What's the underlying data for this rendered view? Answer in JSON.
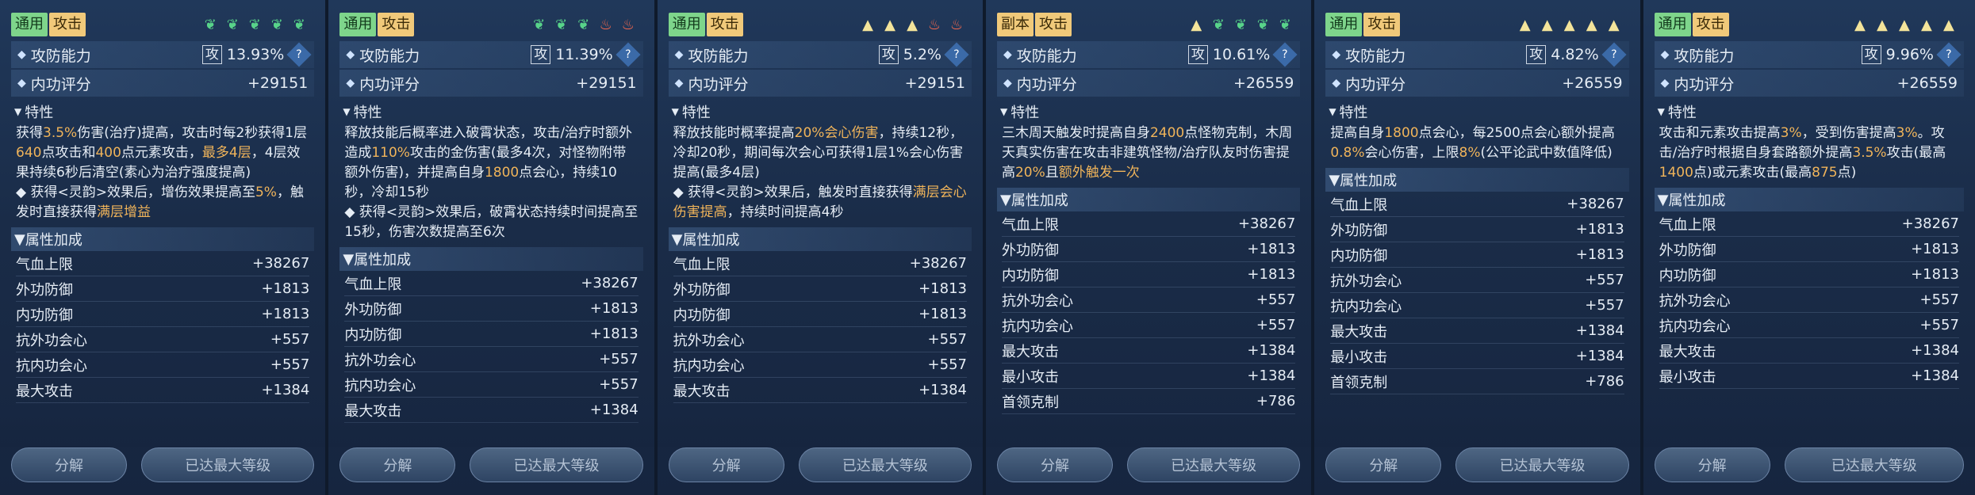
{
  "cards": [
    {
      "tags": [
        {
          "text": "通用",
          "color": "green"
        },
        {
          "text": "攻击",
          "color": "yellow"
        }
      ],
      "icons": [
        "leaf",
        "leaf",
        "leaf",
        "leaf",
        "leaf"
      ],
      "gf_label": "攻防能力",
      "gf_box": "攻",
      "gf_val": "13.93%",
      "q": "?",
      "ng_label": "内功评分",
      "ng_val": "+29151",
      "trait_label": "特性",
      "desc": "获得<span class=hl>3.5%</span>伤害(治疗)提高，攻击时每2秒获得1层<span class=hl>640</span>点攻击和<span class=hl>400</span>点元素攻击，<span class=hl>最多4层</span>，4层效果持续6秒后清空(素心为治疗强度提高)<br>◆ 获得<灵韵>效果后，增伤效果提高至<span class=hl>5%</span>，触发时直接获得<span class=hl>满层增益</span>",
      "attr_label": "属性加成",
      "attrs": [
        [
          "气血上限",
          "+38267"
        ],
        [
          "外功防御",
          "+1813"
        ],
        [
          "内功防御",
          "+1813"
        ],
        [
          "抗外功会心",
          "+557"
        ],
        [
          "抗内功会心",
          "+557"
        ],
        [
          "最大攻击",
          "+1384"
        ]
      ],
      "btn1": "分解",
      "btn2": "已达最大等级"
    },
    {
      "tags": [
        {
          "text": "通用",
          "color": "green"
        },
        {
          "text": "攻击",
          "color": "yellow"
        }
      ],
      "icons": [
        "leaf",
        "leaf",
        "leaf",
        "flame",
        "flame"
      ],
      "gf_label": "攻防能力",
      "gf_box": "攻",
      "gf_val": "11.39%",
      "q": "?",
      "ng_label": "内功评分",
      "ng_val": "+29151",
      "trait_label": "特性",
      "desc": "释放技能后概率进入破霄状态，攻击/治疗时额外造成<span class=hl>110%</span>攻击的金伤害(最多4次，对怪物附带额外伤害)，并提高自身<span class=hl>1800</span>点会心，持续10秒，冷却15秒<br>◆ 获得<灵韵>效果后，破霄状态持续时间提高至15秒，伤害次数提高至6次",
      "attr_label": "属性加成",
      "attrs": [
        [
          "气血上限",
          "+38267"
        ],
        [
          "外功防御",
          "+1813"
        ],
        [
          "内功防御",
          "+1813"
        ],
        [
          "抗外功会心",
          "+557"
        ],
        [
          "抗内功会心",
          "+557"
        ],
        [
          "最大攻击",
          "+1384"
        ]
      ],
      "btn1": "分解",
      "btn2": "已达最大等级"
    },
    {
      "tags": [
        {
          "text": "通用",
          "color": "green"
        },
        {
          "text": "攻击",
          "color": "yellow"
        }
      ],
      "icons": [
        "tri",
        "tri",
        "tri",
        "flame",
        "flame"
      ],
      "gf_label": "攻防能力",
      "gf_box": "攻",
      "gf_val": "5.2%",
      "q": "?",
      "ng_label": "内功评分",
      "ng_val": "+29151",
      "trait_label": "特性",
      "desc": "释放技能时概率提高<span class=hl>20%会心伤害</span>，持续12秒，冷却20秒，期间每次会心可获得1层1%会心伤害提高(最多4层)<br>◆ 获得<灵韵>效果后，触发时直接获得<span class=hl>满层会心伤害提高</span>，持续时间提高4秒",
      "attr_label": "属性加成",
      "attrs": [
        [
          "气血上限",
          "+38267"
        ],
        [
          "外功防御",
          "+1813"
        ],
        [
          "内功防御",
          "+1813"
        ],
        [
          "抗外功会心",
          "+557"
        ],
        [
          "抗内功会心",
          "+557"
        ],
        [
          "最大攻击",
          "+1384"
        ]
      ],
      "btn1": "分解",
      "btn2": "已达最大等级"
    },
    {
      "tags": [
        {
          "text": "副本",
          "color": "yellow"
        },
        {
          "text": "攻击",
          "color": "yellow"
        }
      ],
      "icons": [
        "tri",
        "leaf",
        "leaf",
        "leaf",
        "leaf"
      ],
      "gf_label": "攻防能力",
      "gf_box": "攻",
      "gf_val": "10.61%",
      "q": "?",
      "ng_label": "内功评分",
      "ng_val": "+26559",
      "trait_label": "特性",
      "desc": "三木周天触发时提高自身<span class=hl>2400</span>点怪物克制，木周天真实伤害在攻击非建筑怪物/治疗队友时伤害提高<span class=hl>20%</span>且<span class=hl>额外触发一次</span>",
      "attr_label": "属性加成",
      "attrs": [
        [
          "气血上限",
          "+38267"
        ],
        [
          "外功防御",
          "+1813"
        ],
        [
          "内功防御",
          "+1813"
        ],
        [
          "抗外功会心",
          "+557"
        ],
        [
          "抗内功会心",
          "+557"
        ],
        [
          "最大攻击",
          "+1384"
        ],
        [
          "最小攻击",
          "+1384"
        ],
        [
          "首领克制",
          "+786"
        ]
      ],
      "btn1": "分解",
      "btn2": "已达最大等级"
    },
    {
      "tags": [
        {
          "text": "通用",
          "color": "green"
        },
        {
          "text": "攻击",
          "color": "yellow"
        }
      ],
      "icons": [
        "tri",
        "tri",
        "tri",
        "tri",
        "tri"
      ],
      "gf_label": "攻防能力",
      "gf_box": "攻",
      "gf_val": "4.82%",
      "q": "?",
      "ng_label": "内功评分",
      "ng_val": "+26559",
      "trait_label": "特性",
      "desc": "提高自身<span class=hl>1800</span>点会心，每2500点会心额外提高<span class=hl>0.8%</span>会心伤害，上限<span class=hl>8%</span>(公平论武中数值降低)",
      "attr_label": "属性加成",
      "attrs": [
        [
          "气血上限",
          "+38267"
        ],
        [
          "外功防御",
          "+1813"
        ],
        [
          "内功防御",
          "+1813"
        ],
        [
          "抗外功会心",
          "+557"
        ],
        [
          "抗内功会心",
          "+557"
        ],
        [
          "最大攻击",
          "+1384"
        ],
        [
          "最小攻击",
          "+1384"
        ],
        [
          "首领克制",
          "+786"
        ]
      ],
      "btn1": "分解",
      "btn2": "已达最大等级"
    },
    {
      "tags": [
        {
          "text": "通用",
          "color": "green"
        },
        {
          "text": "攻击",
          "color": "yellow"
        }
      ],
      "icons": [
        "tri",
        "tri",
        "tri",
        "tri",
        "tri"
      ],
      "gf_label": "攻防能力",
      "gf_box": "攻",
      "gf_val": "9.96%",
      "q": "?",
      "ng_label": "内功评分",
      "ng_val": "+26559",
      "trait_label": "特性",
      "desc": "攻击和元素攻击提高<span class=hl>3%</span>，受到伤害提高<span class=hl>3%</span>。攻击/治疗时根据自身套路额外提高<span class=hl>3.5%</span>攻击(最高<span class=hl>1400</span>点)或元素攻击(最高<span class=hl>875</span>点)",
      "attr_label": "属性加成",
      "attrs": [
        [
          "气血上限",
          "+38267"
        ],
        [
          "外功防御",
          "+1813"
        ],
        [
          "内功防御",
          "+1813"
        ],
        [
          "抗外功会心",
          "+557"
        ],
        [
          "抗内功会心",
          "+557"
        ],
        [
          "最大攻击",
          "+1384"
        ],
        [
          "最小攻击",
          "+1384"
        ]
      ],
      "btn1": "分解",
      "btn2": "已达最大等级"
    }
  ]
}
